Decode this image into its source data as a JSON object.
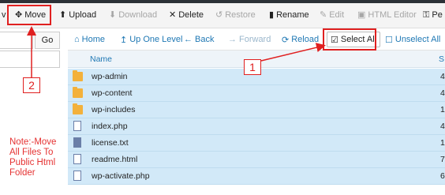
{
  "toolbar": {
    "items": [
      {
        "label": "Move",
        "icon": "arrows-move-icon"
      },
      {
        "label": "Upload",
        "icon": "upload-icon"
      },
      {
        "label": "Download",
        "icon": "download-icon"
      },
      {
        "label": "Delete",
        "icon": "close-icon"
      },
      {
        "label": "Restore",
        "icon": "restore-icon"
      },
      {
        "label": "Rename",
        "icon": "file-icon"
      },
      {
        "label": "Edit",
        "icon": "pencil-icon"
      },
      {
        "label": "HTML Editor",
        "icon": "html-editor-icon"
      },
      {
        "label": "Pe",
        "icon": "key-icon"
      }
    ],
    "leading_glyph": "v"
  },
  "address": {
    "go_label": "Go"
  },
  "nav": {
    "home": "Home",
    "up": "Up One Level",
    "back": "Back",
    "forward": "Forward",
    "reload": "Reload",
    "select_all": "Select All",
    "unselect_all": "Unselect All"
  },
  "list": {
    "columns": {
      "name": "Name",
      "size": "S"
    },
    "rows": [
      {
        "name": "wp-admin",
        "type": "folder",
        "size": "4"
      },
      {
        "name": "wp-content",
        "type": "folder",
        "size": "4"
      },
      {
        "name": "wp-includes",
        "type": "folder",
        "size": "1"
      },
      {
        "name": "index.php",
        "type": "file",
        "size": "4"
      },
      {
        "name": "license.txt",
        "type": "text",
        "size": "1"
      },
      {
        "name": "readme.html",
        "type": "file",
        "size": "7"
      },
      {
        "name": "wp-activate.php",
        "type": "file",
        "size": "6"
      }
    ]
  },
  "annotations": {
    "marker1": "1",
    "marker2": "2",
    "note": "Note:-Move All Files To Public Html Folder",
    "color": "#e02020"
  }
}
